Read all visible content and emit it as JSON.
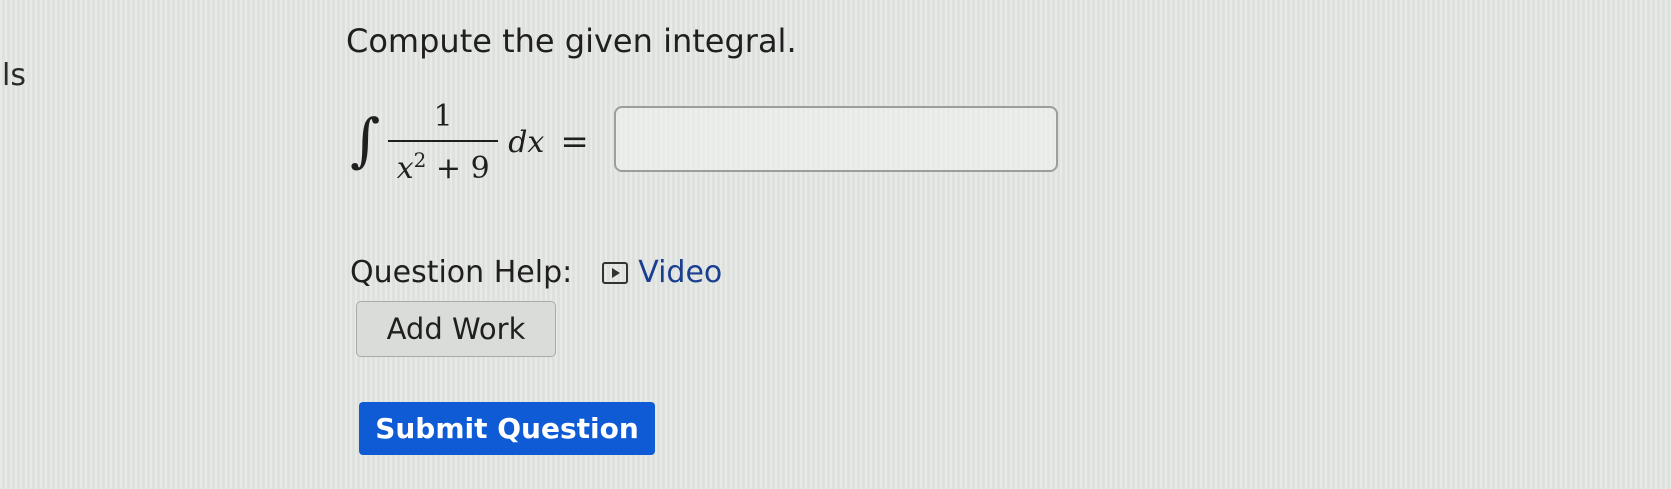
{
  "sidebar": {
    "partial_text": "ls"
  },
  "question": {
    "prompt": "Compute the given integral.",
    "integral": {
      "symbol": "∫",
      "numerator": "1",
      "denominator_var": "x",
      "denominator_exp": "2",
      "denominator_rest": " + 9",
      "differential": "dx",
      "equals": "="
    },
    "answer": {
      "value": "",
      "placeholder": ""
    }
  },
  "help": {
    "label": "Question Help:",
    "video_label": "Video",
    "video_icon": "play-video-icon"
  },
  "actions": {
    "add_work_label": "Add Work",
    "submit_label": "Submit Question"
  },
  "colors": {
    "submit_bg": "#0e5bd5",
    "link": "#1b3f8f",
    "background": "#e3e5e2"
  }
}
